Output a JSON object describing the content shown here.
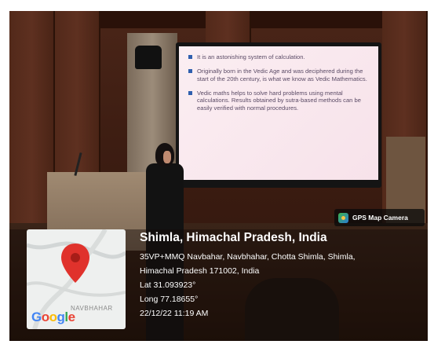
{
  "slide": {
    "bullets": [
      "It is an astonishing system of calculation.",
      "Originally born in the Vedic Age and was deciphered during the start of the 20th century, is what we know as Vedic Mathematics.",
      "Vedic maths helps to solve hard problems using mental calculations. Results obtained by sutra-based methods can be easily verified with normal procedures."
    ],
    "bullet_color": "#2f5fae"
  },
  "gps": {
    "app_label": "GPS Map Camera",
    "title": "Shimla, Himachal Pradesh, India",
    "address_line1": "35VP+MMQ Navbahar, Navbhahar, Chotta Shimla, Shimla,",
    "address_line2": "Himachal Pradesh 171002, India",
    "latitude": "Lat 31.093923°",
    "longitude": "Long 77.18655°",
    "timestamp": "22/12/22 11:19 AM"
  },
  "map": {
    "place_label": "NAVBHAHAR",
    "logo": "Google",
    "pin_color": "#e0322c",
    "icon": "location-pin-icon"
  }
}
